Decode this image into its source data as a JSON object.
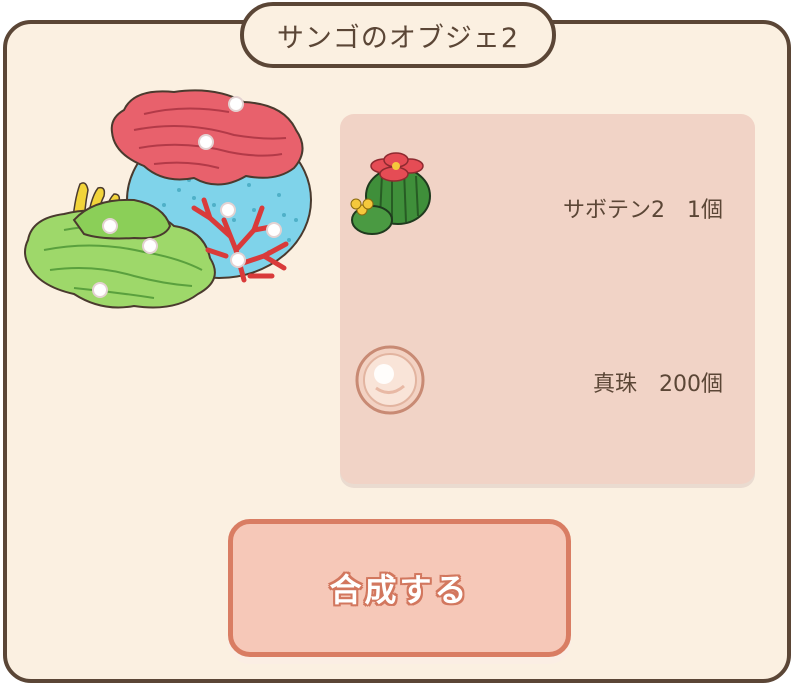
{
  "dialog": {
    "title": "サンゴのオブジェ2",
    "item_icon": "coral-object-icon"
  },
  "materials": [
    {
      "icon": "cactus-icon",
      "label": "サボテン2　1個"
    },
    {
      "icon": "pearl-icon",
      "label": "真珠　200個"
    }
  ],
  "actions": {
    "craft_label": "合成する"
  },
  "colors": {
    "panel_bg": "#fbf0e1",
    "border": "#5b4636",
    "materials_bg": "#f1d3c6",
    "button_bg": "#f6c8b8",
    "button_border": "#d97d63"
  }
}
